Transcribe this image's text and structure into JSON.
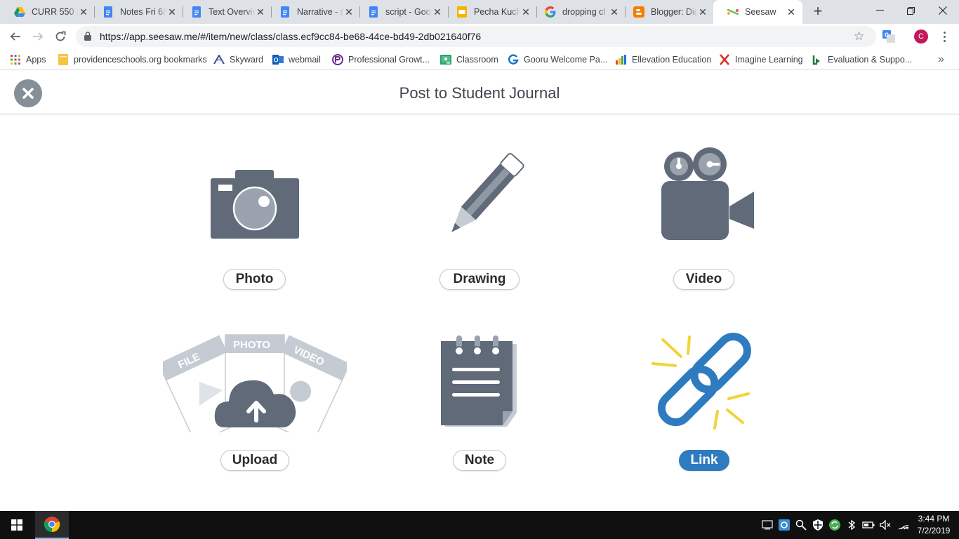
{
  "browser": {
    "tabs": [
      {
        "title": "CURR 550 D",
        "icon": "google-drive-icon"
      },
      {
        "title": "Notes Fri 6/",
        "icon": "google-docs-icon"
      },
      {
        "title": "Text Overvie",
        "icon": "google-docs-icon"
      },
      {
        "title": "Narrative - (",
        "icon": "google-docs-icon"
      },
      {
        "title": "script - Goo",
        "icon": "google-docs-icon"
      },
      {
        "title": "Pecha Kuch",
        "icon": "google-slides-icon"
      },
      {
        "title": "dropping cl",
        "icon": "google-icon"
      },
      {
        "title": "Blogger: Dig",
        "icon": "blogger-icon"
      },
      {
        "title": "Seesaw",
        "icon": "seesaw-icon"
      }
    ],
    "url": "https://app.seesaw.me/#/item/new/class/class.ecf9cc84-be68-44ce-bd49-2db021640f76",
    "profile_initial": "C",
    "bookmarks": [
      {
        "label": "Apps"
      },
      {
        "label": "providenceschools.org bookmarks"
      },
      {
        "label": "Skyward"
      },
      {
        "label": "webmail"
      },
      {
        "label": "Professional Growt..."
      },
      {
        "label": "Classroom"
      },
      {
        "label": "Gooru Welcome Pa..."
      },
      {
        "label": "Ellevation Education"
      },
      {
        "label": "Imagine Learning"
      },
      {
        "label": "Evaluation & Suppo..."
      }
    ]
  },
  "seesaw": {
    "title": "Post to Student Journal",
    "options": [
      {
        "label": "Photo",
        "icon": "camera-icon"
      },
      {
        "label": "Drawing",
        "icon": "pencil-icon"
      },
      {
        "label": "Video",
        "icon": "video-camera-icon"
      },
      {
        "label": "Upload",
        "icon": "upload-cloud-icon",
        "card_labels": [
          "FILE",
          "PHOTO",
          "VIDEO"
        ]
      },
      {
        "label": "Note",
        "icon": "notepad-icon"
      },
      {
        "label": "Link",
        "icon": "link-icon",
        "highlighted": true
      }
    ],
    "colors": {
      "icon_gray": "#606a78",
      "link_blue": "#2f7bbf",
      "link_spark": "#f2d33a"
    }
  },
  "taskbar": {
    "time": "3:44 PM",
    "date": "7/2/2019"
  }
}
